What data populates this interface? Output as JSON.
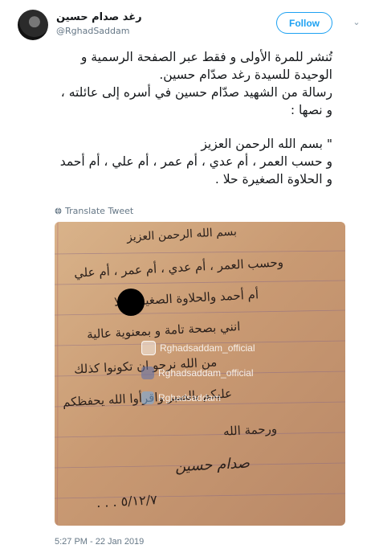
{
  "author": {
    "display_name": "رغد صدام حسين",
    "handle": "@RghadSaddam"
  },
  "actions": {
    "follow_label": "Follow"
  },
  "tweet": {
    "paragraphs": [
      "تُنشر للمرة الأولى و فقط عبر الصفحة الرسمية و الوحيدة للسيدة رغد صدّام حسين.",
      "رسالة من الشهيد صدّام حسين في أسره إلى عائلته ، و نصها :",
      "\" بسم الله الرحمن العزيز",
      "و حسب العمر ، أم عدي ، أم عمر ، أم علي ، أم أحمد و الحلاوة الصغيرة حلا ."
    ],
    "translate_label": "Translate Tweet",
    "timestamp": "5:27 PM - 22 Jan 2019"
  },
  "letter": {
    "lines": [
      "بسم الله الرحمن العزيز",
      "وحسب العمر ، أم عدي ، أم عمر ، أم علي",
      "أم أحمد والحلاوة الصغيرة حلا",
      "انني بصحة تامة و بمعنوية عالية",
      "من الله نرجو ان تكونوا كذلك",
      "عليكم بالصبر واقرأوا الله يحفظكم",
      "ورحمة الله",
      "٥/١٢/٧ . . ."
    ],
    "signature": "صدام حسين",
    "watermarks": [
      "Rghadsaddam_official",
      "Rghadsaddam_official",
      "Rghadsaddam"
    ]
  },
  "colors": {
    "accent": "#1da1f2",
    "text": "#14171a",
    "muted": "#657786",
    "paper": "#c99a73"
  },
  "icons": {
    "caret": "chevron-down-icon",
    "translate": "globe-icon"
  }
}
